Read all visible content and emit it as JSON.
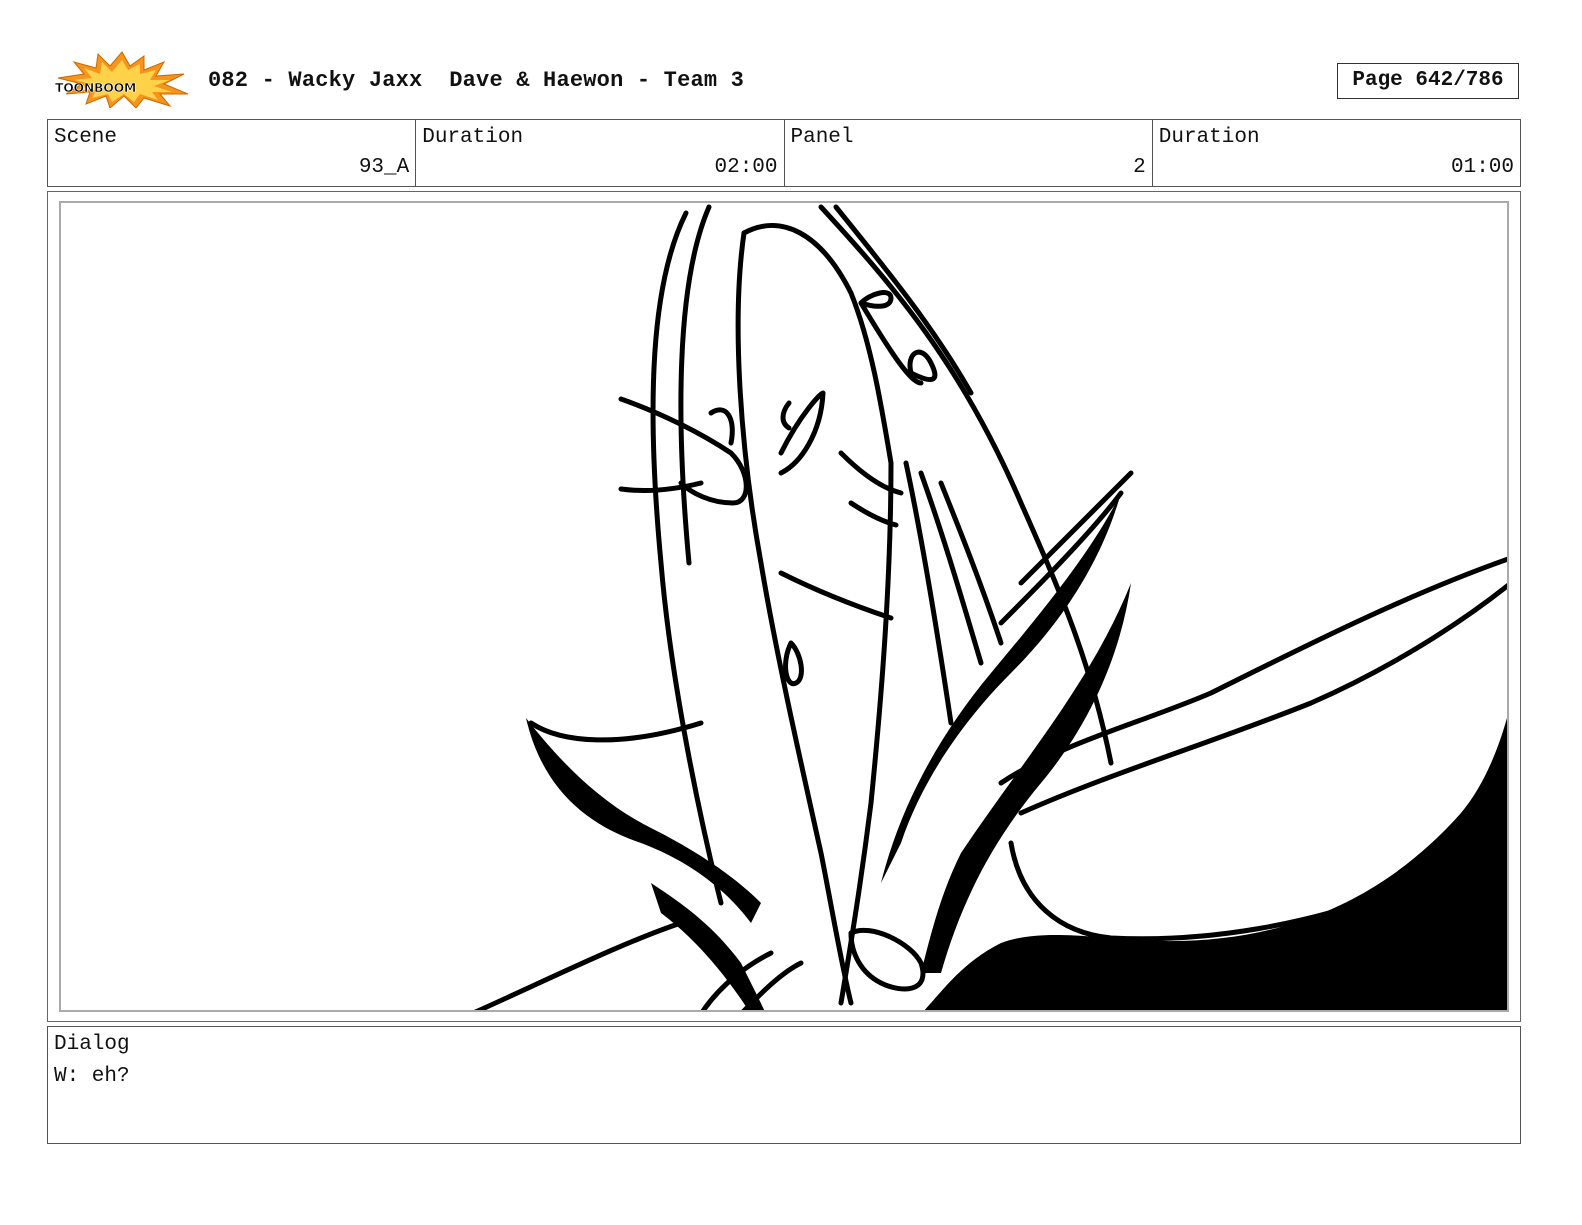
{
  "header": {
    "logo_text": "TOONBOOM",
    "title": "082 - Wacky Jaxx  Dave & Haewon - Team 3",
    "page": "Page 642/786"
  },
  "info": {
    "scene_label": "Scene",
    "scene_value": "93_A",
    "duration_label": "Duration",
    "duration_value": "02:00",
    "panel_label": "Panel",
    "panel_value": "2",
    "panel_duration_label": "Duration",
    "panel_duration_value": "01:00"
  },
  "panel_image": {
    "icon": "storyboard-sketch"
  },
  "dialog": {
    "label": "Dialog",
    "text": "W: eh?"
  }
}
